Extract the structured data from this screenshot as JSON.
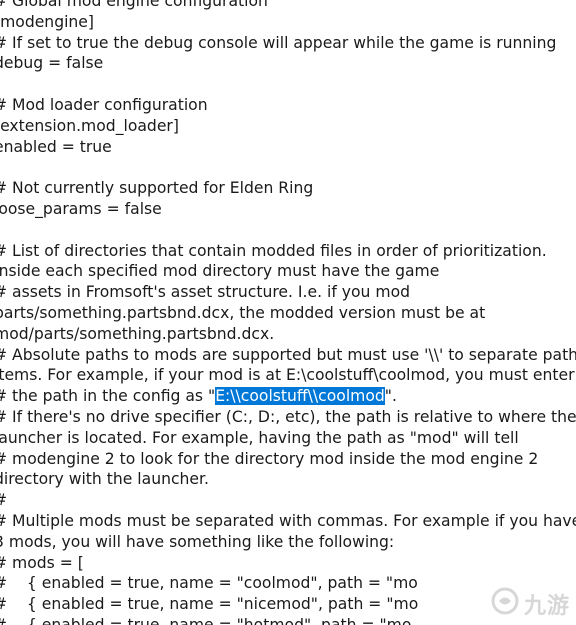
{
  "document": {
    "lines": [
      "# Global mod engine configuration",
      "[modengine]",
      "# If set to true the debug console will appear while the game is running",
      "debug = false",
      "",
      "# Mod loader configuration",
      "[extension.mod_loader]",
      "enabled = true",
      "",
      "# Not currently supported for Elden Ring",
      "loose_params = false",
      "",
      "# List of directories that contain modded files in order of prioritization.",
      "Inside each specified mod directory must have the game",
      "# assets in Fromsoft's asset structure. I.e. if you mod",
      "parts/something.partsbnd.dcx, the modded version must be at",
      "mod/parts/something.partsbnd.dcx.",
      "# Absolute paths to mods are supported but must use '\\\\' to separate path",
      "items. For example, if your mod is at E:\\coolstuff\\coolmod, you must enter",
      "",
      "# If there's no drive specifier (C:, D:, etc), the path is relative to where the",
      "launcher is located. For example, having the path as \"mod\" will tell",
      "# modengine 2 to look for the directory mod inside the mod engine 2",
      "directory with the launcher.",
      "#",
      "# Multiple mods must be separated with commas. For example if you have",
      "3 mods, you will have something like the following:",
      "# mods = [",
      "#    { enabled = true, name = \"coolmod\", path = \"mo",
      "#    { enabled = true, name = \"nicemod\", path = \"mo",
      "#    { enabled = true, name = \"hotmod\", path = \"mo"
    ],
    "selected_line": {
      "before": "# the path in the config as \"",
      "selected": "E:\\\\coolstuff\\\\coolmod",
      "after": "\"."
    }
  },
  "watermark": {
    "icon": "jiuyou-logo-icon",
    "text": "九游"
  }
}
